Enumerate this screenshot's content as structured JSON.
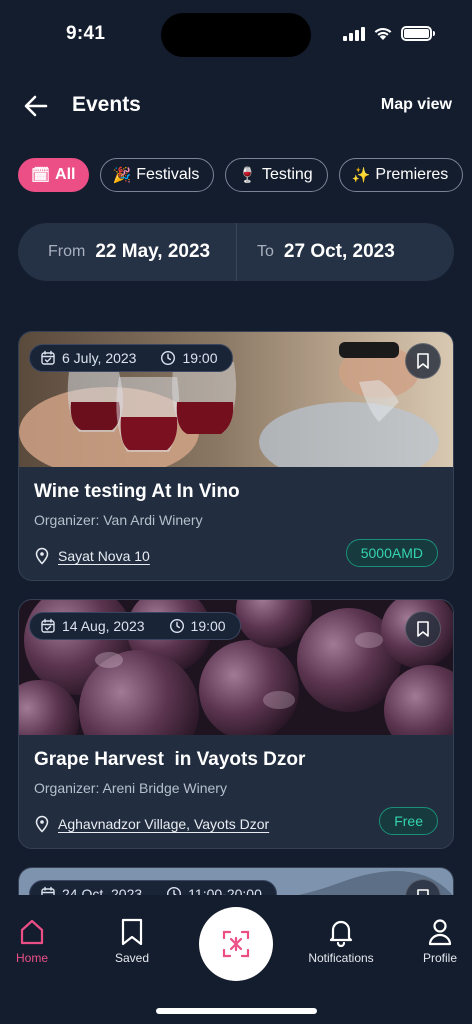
{
  "status_bar": {
    "time": "9:41"
  },
  "header": {
    "title": "Events",
    "map_view_label": "Map view"
  },
  "filters": [
    {
      "emoji": "🗓",
      "label": "All",
      "active": true
    },
    {
      "emoji": "🎉",
      "label": "Festivals",
      "active": false
    },
    {
      "emoji": "🍷",
      "label": "Testing",
      "active": false
    },
    {
      "emoji": "✨",
      "label": "Premieres",
      "active": false
    }
  ],
  "date_range": {
    "from_label": "From",
    "from_value": "22 May, 2023",
    "to_label": "To",
    "to_value": "27 Oct, 2023"
  },
  "events": [
    {
      "date": "6 July, 2023",
      "time": "19:00",
      "title": "Wine testing At In Vino",
      "organizer": "Organizer: Van Ardi Winery",
      "location": "Sayat Nova 10",
      "price": "5000AMD"
    },
    {
      "date": "14 Aug, 2023",
      "time": "19:00",
      "title": "Grape Harvest  in Vayots Dzor",
      "organizer": "Organizer: Areni Bridge Winery",
      "location": "Aghavnadzor Village, Vayots Dzor",
      "price": "Free"
    },
    {
      "date": "24 Oct, 2023",
      "time": "11:00-20:00"
    }
  ],
  "bottom_nav": {
    "home": "Home",
    "saved": "Saved",
    "notifications": "Notifications",
    "profile": "Profile"
  },
  "colors": {
    "background": "#141d2e",
    "accent": "#ec4f86",
    "card": "#222e40",
    "price_text": "#34d3b0"
  }
}
